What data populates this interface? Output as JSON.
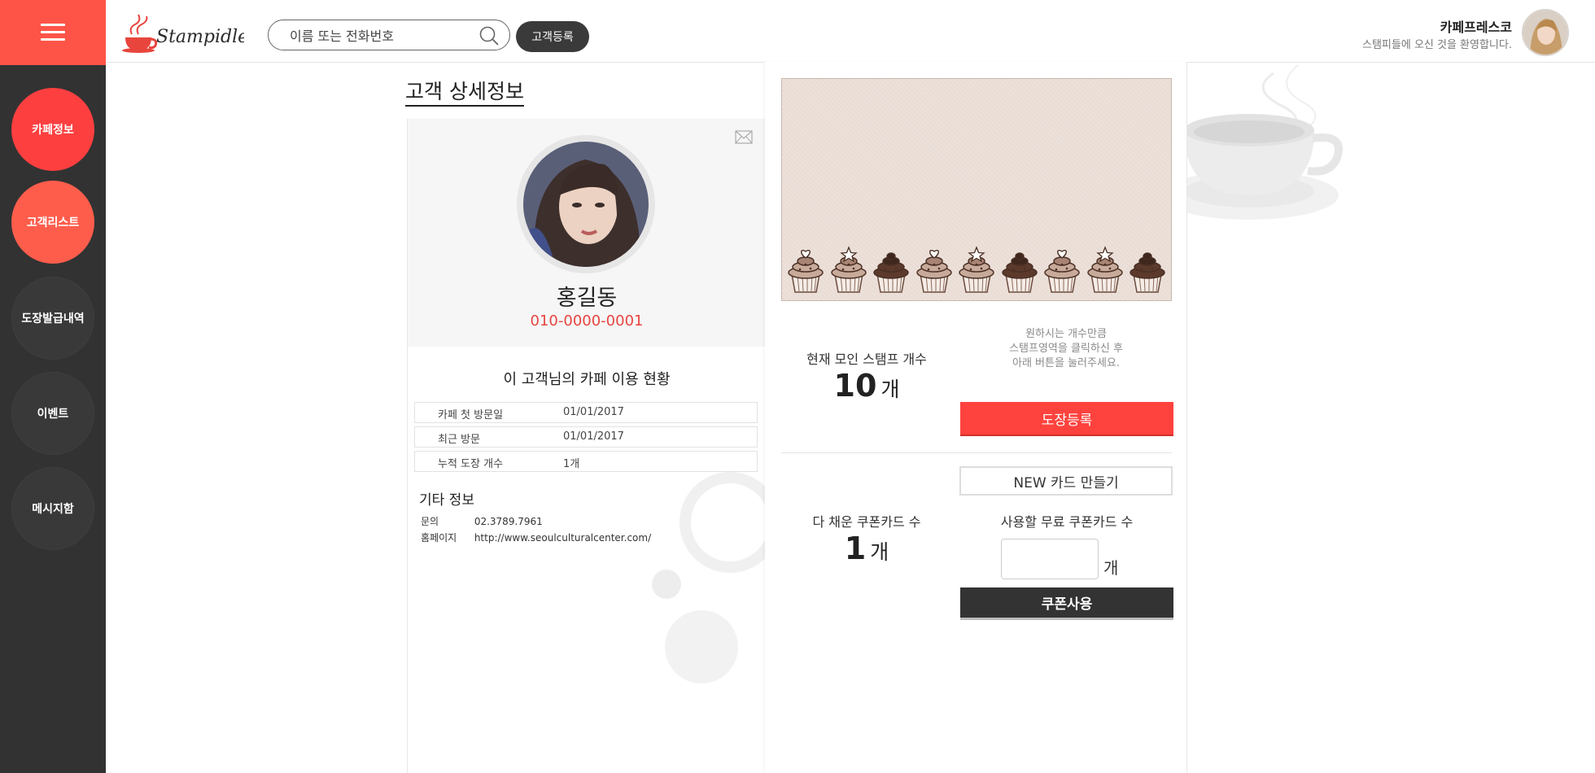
{
  "header": {
    "search_placeholder": "이름 또는 전화번호",
    "register_label": "고객등록",
    "shop_name": "카페프레스코",
    "welcome": "스탬피들에 오신 것을 환영합니다."
  },
  "sidebar": {
    "items": [
      {
        "label": "카페정보"
      },
      {
        "label": "고객리스트"
      },
      {
        "label": "도장발급내역"
      },
      {
        "label": "이벤트"
      },
      {
        "label": "메시지함"
      }
    ]
  },
  "page": {
    "title": "고객 상세정보"
  },
  "customer": {
    "name": "홍길동",
    "phone": "010-0000-0001"
  },
  "usage": {
    "title": "이 고객님의 카페 이용 현황",
    "rows": [
      {
        "key": "카페 첫 방문일",
        "value": "01/01/2017"
      },
      {
        "key": "최근 방문",
        "value": "01/01/2017"
      },
      {
        "key": "누적 도장 개수",
        "value": "1개"
      }
    ]
  },
  "etc": {
    "title": "기타 정보",
    "rows": [
      {
        "key": "문의",
        "value": "02.3789.7961"
      },
      {
        "key": "홈페이지",
        "value": "http://www.seoulculturalcenter.com/"
      }
    ]
  },
  "stamp": {
    "current_label": "현재 모인 스탬프 개수",
    "current_count": "10",
    "unit": "개",
    "hint_lines": [
      "원하시는 개수만큼",
      "스탬프영역을 클릭하신 후",
      "아래 버튼을 눌러주세요."
    ],
    "register_button": "도장등록",
    "new_card_button": "NEW 카드 만들기",
    "cupcake_icons": [
      "heart",
      "star",
      "plain",
      "heart",
      "star",
      "plain",
      "heart",
      "star",
      "plain"
    ]
  },
  "coupon": {
    "full_label": "다 채운 쿠폰카드 수",
    "full_count": "1",
    "unit": "개",
    "free_label": "사용할 무료 쿠폰카드 수",
    "input_value": "",
    "input_unit": "개",
    "use_button": "쿠폰사용"
  },
  "colors": {
    "accent_red": "#fe3f40",
    "sidebar_bg": "#323232",
    "phone_red": "#e64540"
  }
}
